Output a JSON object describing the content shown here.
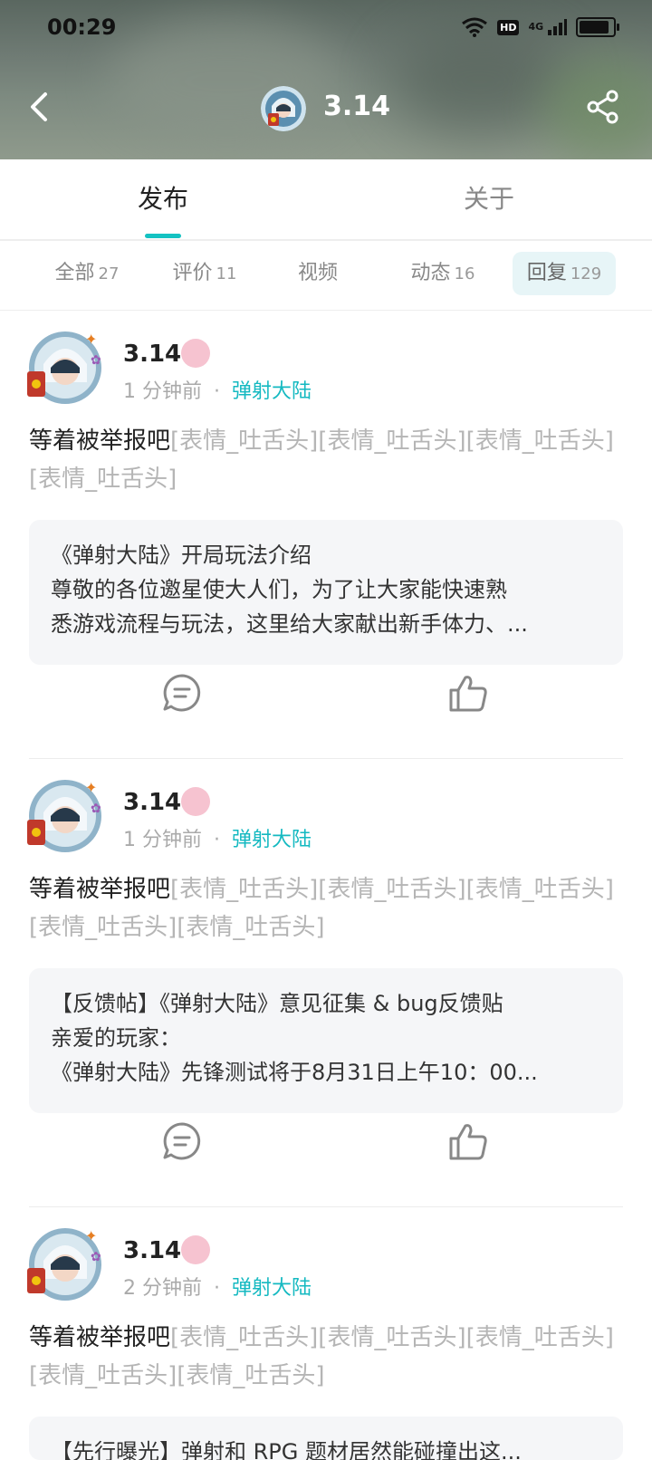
{
  "status_bar": {
    "time": "00:29",
    "hd": "HD",
    "network": "4G"
  },
  "header": {
    "title": "3.14"
  },
  "main_tabs": [
    {
      "label": "发布",
      "active": true
    },
    {
      "label": "关于",
      "active": false
    }
  ],
  "sub_tabs": [
    {
      "label": "全部",
      "count": "27"
    },
    {
      "label": "评价",
      "count": "11"
    },
    {
      "label": "视频",
      "count": ""
    },
    {
      "label": "动态",
      "count": "16"
    },
    {
      "label": "回复",
      "count": "129",
      "active": true
    }
  ],
  "posts": [
    {
      "author": "3.14",
      "time": "1 分钟前",
      "separator": "·",
      "game": "弹射大陆",
      "text": "等着被举报吧",
      "emojis": "[表情_吐舌头][表情_吐舌头][表情_吐舌头][表情_吐舌头]",
      "quote": {
        "title": "《弹射大陆》开局玩法介绍",
        "line1": "尊敬的各位邀星使大人们，为了让大家能快速熟",
        "line2": "悉游戏流程与玩法，这里给大家献出新手体力、..."
      }
    },
    {
      "author": "3.14",
      "time": "1 分钟前",
      "separator": "·",
      "game": "弹射大陆",
      "text": "等着被举报吧",
      "emojis": "[表情_吐舌头][表情_吐舌头][表情_吐舌头][表情_吐舌头][表情_吐舌头]",
      "quote": {
        "title": "【反馈帖】《弹射大陆》意见征集 & bug反馈贴",
        "line1": "亲爱的玩家：",
        "line2": "《弹射大陆》先锋测试将于8月31日上午10：00..."
      }
    },
    {
      "author": "3.14",
      "time": "2 分钟前",
      "separator": "·",
      "game": "弹射大陆",
      "text": "等着被举报吧",
      "emojis": "[表情_吐舌头][表情_吐舌头][表情_吐舌头][表情_吐舌头][表情_吐舌头]",
      "quote": {
        "title": "【先行曝光】弹射和 RPG 题材居然能碰撞出这..."
      }
    }
  ],
  "colors": {
    "accent": "#14c2c2",
    "game_link": "#14b9c1",
    "emoji_text": "#b5b5b5"
  }
}
